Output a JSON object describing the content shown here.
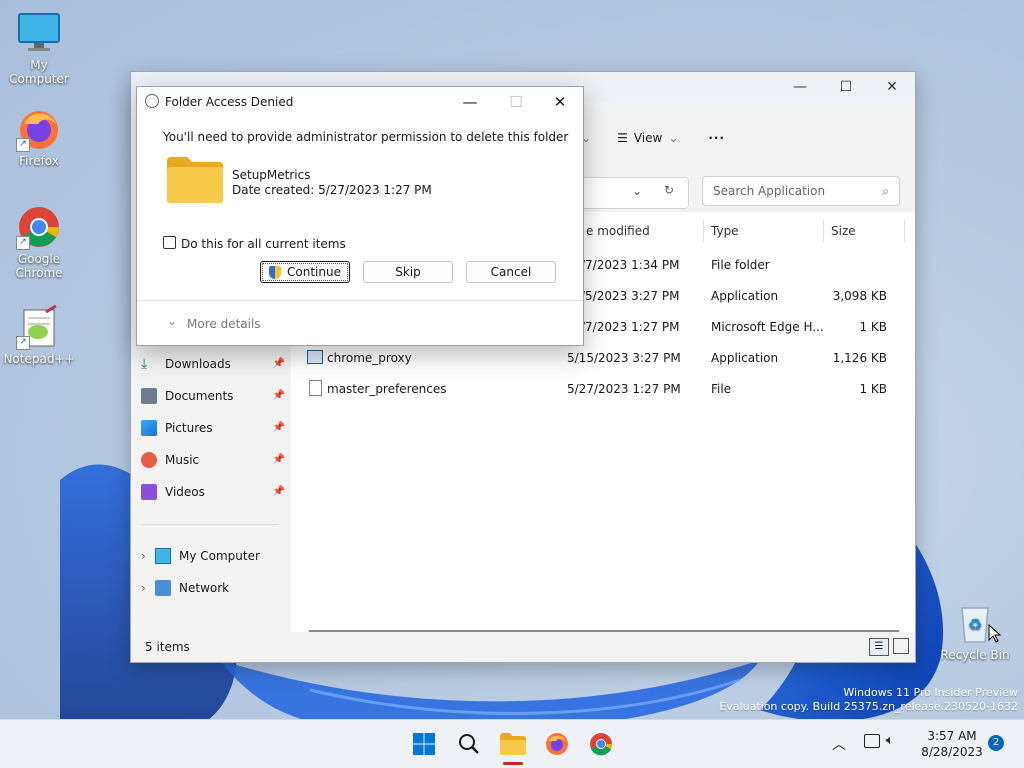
{
  "desktop": {
    "icons": [
      {
        "label": "My Computer"
      },
      {
        "label": "Firefox"
      },
      {
        "label": "Google Chrome"
      },
      {
        "label": "Notepad++"
      },
      {
        "label": "Recycle Bin"
      }
    ],
    "watermark": {
      "line1": "Windows 11 Pro Insider Preview",
      "line2": "Evaluation copy. Build 25375.zn_release.230520-1632"
    }
  },
  "explorer": {
    "toolbar": {
      "view_label": "View",
      "more_label": "···"
    },
    "search": {
      "placeholder": "Search Application"
    },
    "columns": {
      "date": "e modified",
      "type": "Type",
      "size": "Size"
    },
    "rows": [
      {
        "name": "",
        "date": "/7/2023 1:34 PM",
        "type": "File folder",
        "size": ""
      },
      {
        "name": "",
        "date": "/5/2023 3:27 PM",
        "type": "Application",
        "size": "3,098 KB"
      },
      {
        "name": "",
        "date": "/7/2023 1:27 PM",
        "type": "Microsoft Edge H...",
        "size": "1 KB"
      },
      {
        "name": "chrome_proxy",
        "date": "5/15/2023 3:27 PM",
        "type": "Application",
        "size": "1,126 KB"
      },
      {
        "name": "master_preferences",
        "date": "5/27/2023 1:27 PM",
        "type": "File",
        "size": "1 KB"
      }
    ],
    "nav": {
      "quick": [
        {
          "label": "Downloads"
        },
        {
          "label": "Documents"
        },
        {
          "label": "Pictures"
        },
        {
          "label": "Music"
        },
        {
          "label": "Videos"
        }
      ],
      "tree": [
        {
          "label": "My Computer"
        },
        {
          "label": "Network"
        }
      ]
    },
    "status": "5 items"
  },
  "dialog": {
    "title": "Folder Access Denied",
    "message": "You'll need to provide administrator permission to delete this folder",
    "folder_name": "SetupMetrics",
    "date_created": "Date created: 5/27/2023 1:27 PM",
    "checkbox_label": "Do this for all current items",
    "buttons": {
      "continue": "Continue",
      "skip": "Skip",
      "cancel": "Cancel"
    },
    "more_details": "More details"
  },
  "taskbar": {
    "time": "3:57 AM",
    "date": "8/28/2023",
    "notification_count": "2"
  },
  "colors": {
    "accent": "#0067c0",
    "folder": "#f8c94a"
  }
}
